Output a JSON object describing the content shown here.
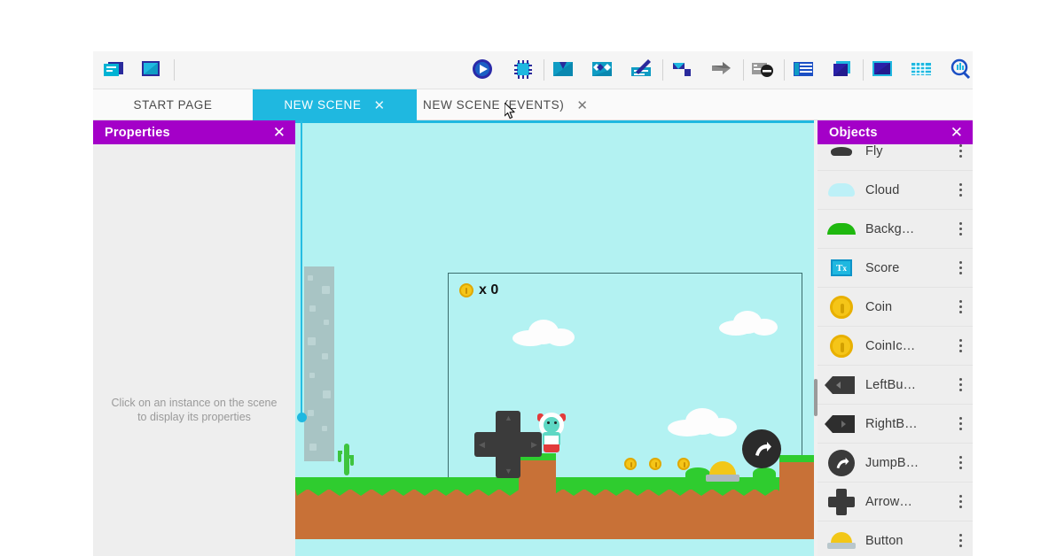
{
  "app": {
    "name": "GDevelop Scene Editor"
  },
  "toolbar": {
    "items": [
      {
        "name": "open-project-icon",
        "label": "Open Project"
      },
      {
        "name": "save-project-icon",
        "label": "Save Project"
      },
      {
        "name": "preview-play-icon",
        "label": "Preview"
      },
      {
        "name": "network-preview-icon",
        "label": "Network Preview"
      },
      {
        "name": "import-scene-icon",
        "label": "Import"
      },
      {
        "name": "duplicate-icon",
        "label": "Duplicate"
      },
      {
        "name": "edit-icon",
        "label": "Edit"
      },
      {
        "name": "undo-icon",
        "label": "Undo"
      },
      {
        "name": "redo-icon",
        "label": "Redo"
      },
      {
        "name": "debug-disabled-icon",
        "label": "Debugger"
      },
      {
        "name": "properties-list-icon",
        "label": "Properties"
      },
      {
        "name": "layers-icon",
        "label": "Layers"
      },
      {
        "name": "scene-frame-icon",
        "label": "Scene Frame"
      },
      {
        "name": "grid-icon",
        "label": "Grid"
      },
      {
        "name": "zoom-search-icon",
        "label": "Zoom"
      }
    ]
  },
  "tabs": [
    {
      "label": "START PAGE",
      "active": false,
      "closable": false
    },
    {
      "label": "NEW SCENE",
      "active": true,
      "closable": true
    },
    {
      "label": "NEW SCENE (EVENTS)",
      "active": false,
      "closable": true
    }
  ],
  "properties_panel": {
    "title": "Properties",
    "close_label": "✕",
    "empty_message": "Click on an instance on the scene to display its properties"
  },
  "objects_panel": {
    "title": "Objects",
    "close_label": "✕",
    "menu_label": "⋮",
    "items": [
      {
        "label": "Fly",
        "icon": "fly-thumbnail"
      },
      {
        "label": "Cloud",
        "icon": "cloud-thumbnail"
      },
      {
        "label": "Backg…",
        "icon": "background-thumbnail"
      },
      {
        "label": "Score",
        "icon": "score-text-thumbnail"
      },
      {
        "label": "Coin",
        "icon": "coin-thumbnail"
      },
      {
        "label": "CoinIc…",
        "icon": "coin-icon-thumbnail"
      },
      {
        "label": "LeftBu…",
        "icon": "left-button-thumbnail"
      },
      {
        "label": "RightB…",
        "icon": "right-button-thumbnail"
      },
      {
        "label": "JumpB…",
        "icon": "jump-button-thumbnail"
      },
      {
        "label": "Arrow…",
        "icon": "arrow-pad-thumbnail"
      },
      {
        "label": "Button",
        "icon": "button-thumbnail"
      }
    ]
  },
  "scene": {
    "hud": {
      "coin_icon": "coin-icon",
      "score_text": "x 0"
    },
    "colors": {
      "sky": "#b3f2f2",
      "grass": "#2fcc2f",
      "dirt": "#c87137",
      "coin": "#f5c518",
      "accent_blue": "#1fb8e0",
      "panel_purple": "#a400c8"
    },
    "instances": [
      {
        "name": "brick-column",
        "count": 1
      },
      {
        "name": "cloud",
        "count": 4
      },
      {
        "name": "cactus",
        "count": 1
      },
      {
        "name": "coin",
        "count": 5
      },
      {
        "name": "hero-character",
        "count": 1
      },
      {
        "name": "arrow-pad",
        "count": 1
      },
      {
        "name": "jump-button",
        "count": 1
      },
      {
        "name": "yellow-button",
        "count": 1
      },
      {
        "name": "slime-enemy",
        "count": 1
      },
      {
        "name": "nut-row",
        "count": 3
      }
    ]
  }
}
